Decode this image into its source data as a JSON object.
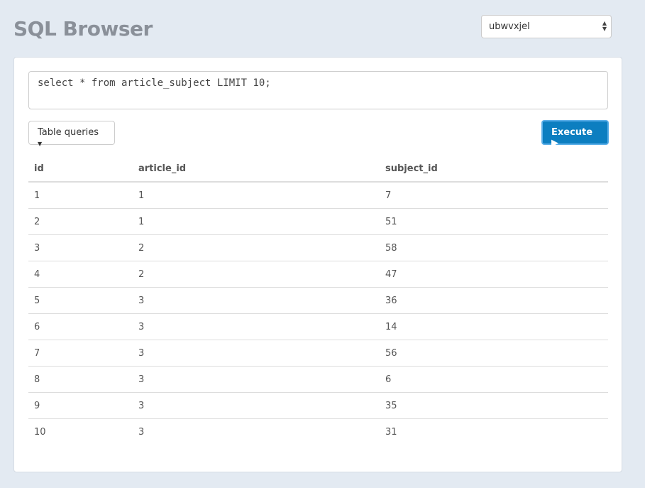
{
  "header": {
    "title": "SQL Browser",
    "database_select": "ubwvxjel"
  },
  "query": {
    "text": "select * from article_subject LIMIT 10;"
  },
  "toolbar": {
    "table_queries_label": "Table queries",
    "execute_label": "Execute"
  },
  "results": {
    "columns": [
      "id",
      "article_id",
      "subject_id"
    ],
    "rows": [
      [
        "1",
        "1",
        "7"
      ],
      [
        "2",
        "1",
        "51"
      ],
      [
        "3",
        "2",
        "58"
      ],
      [
        "4",
        "2",
        "47"
      ],
      [
        "5",
        "3",
        "36"
      ],
      [
        "6",
        "3",
        "14"
      ],
      [
        "7",
        "3",
        "56"
      ],
      [
        "8",
        "3",
        "6"
      ],
      [
        "9",
        "3",
        "35"
      ],
      [
        "10",
        "3",
        "31"
      ]
    ]
  }
}
